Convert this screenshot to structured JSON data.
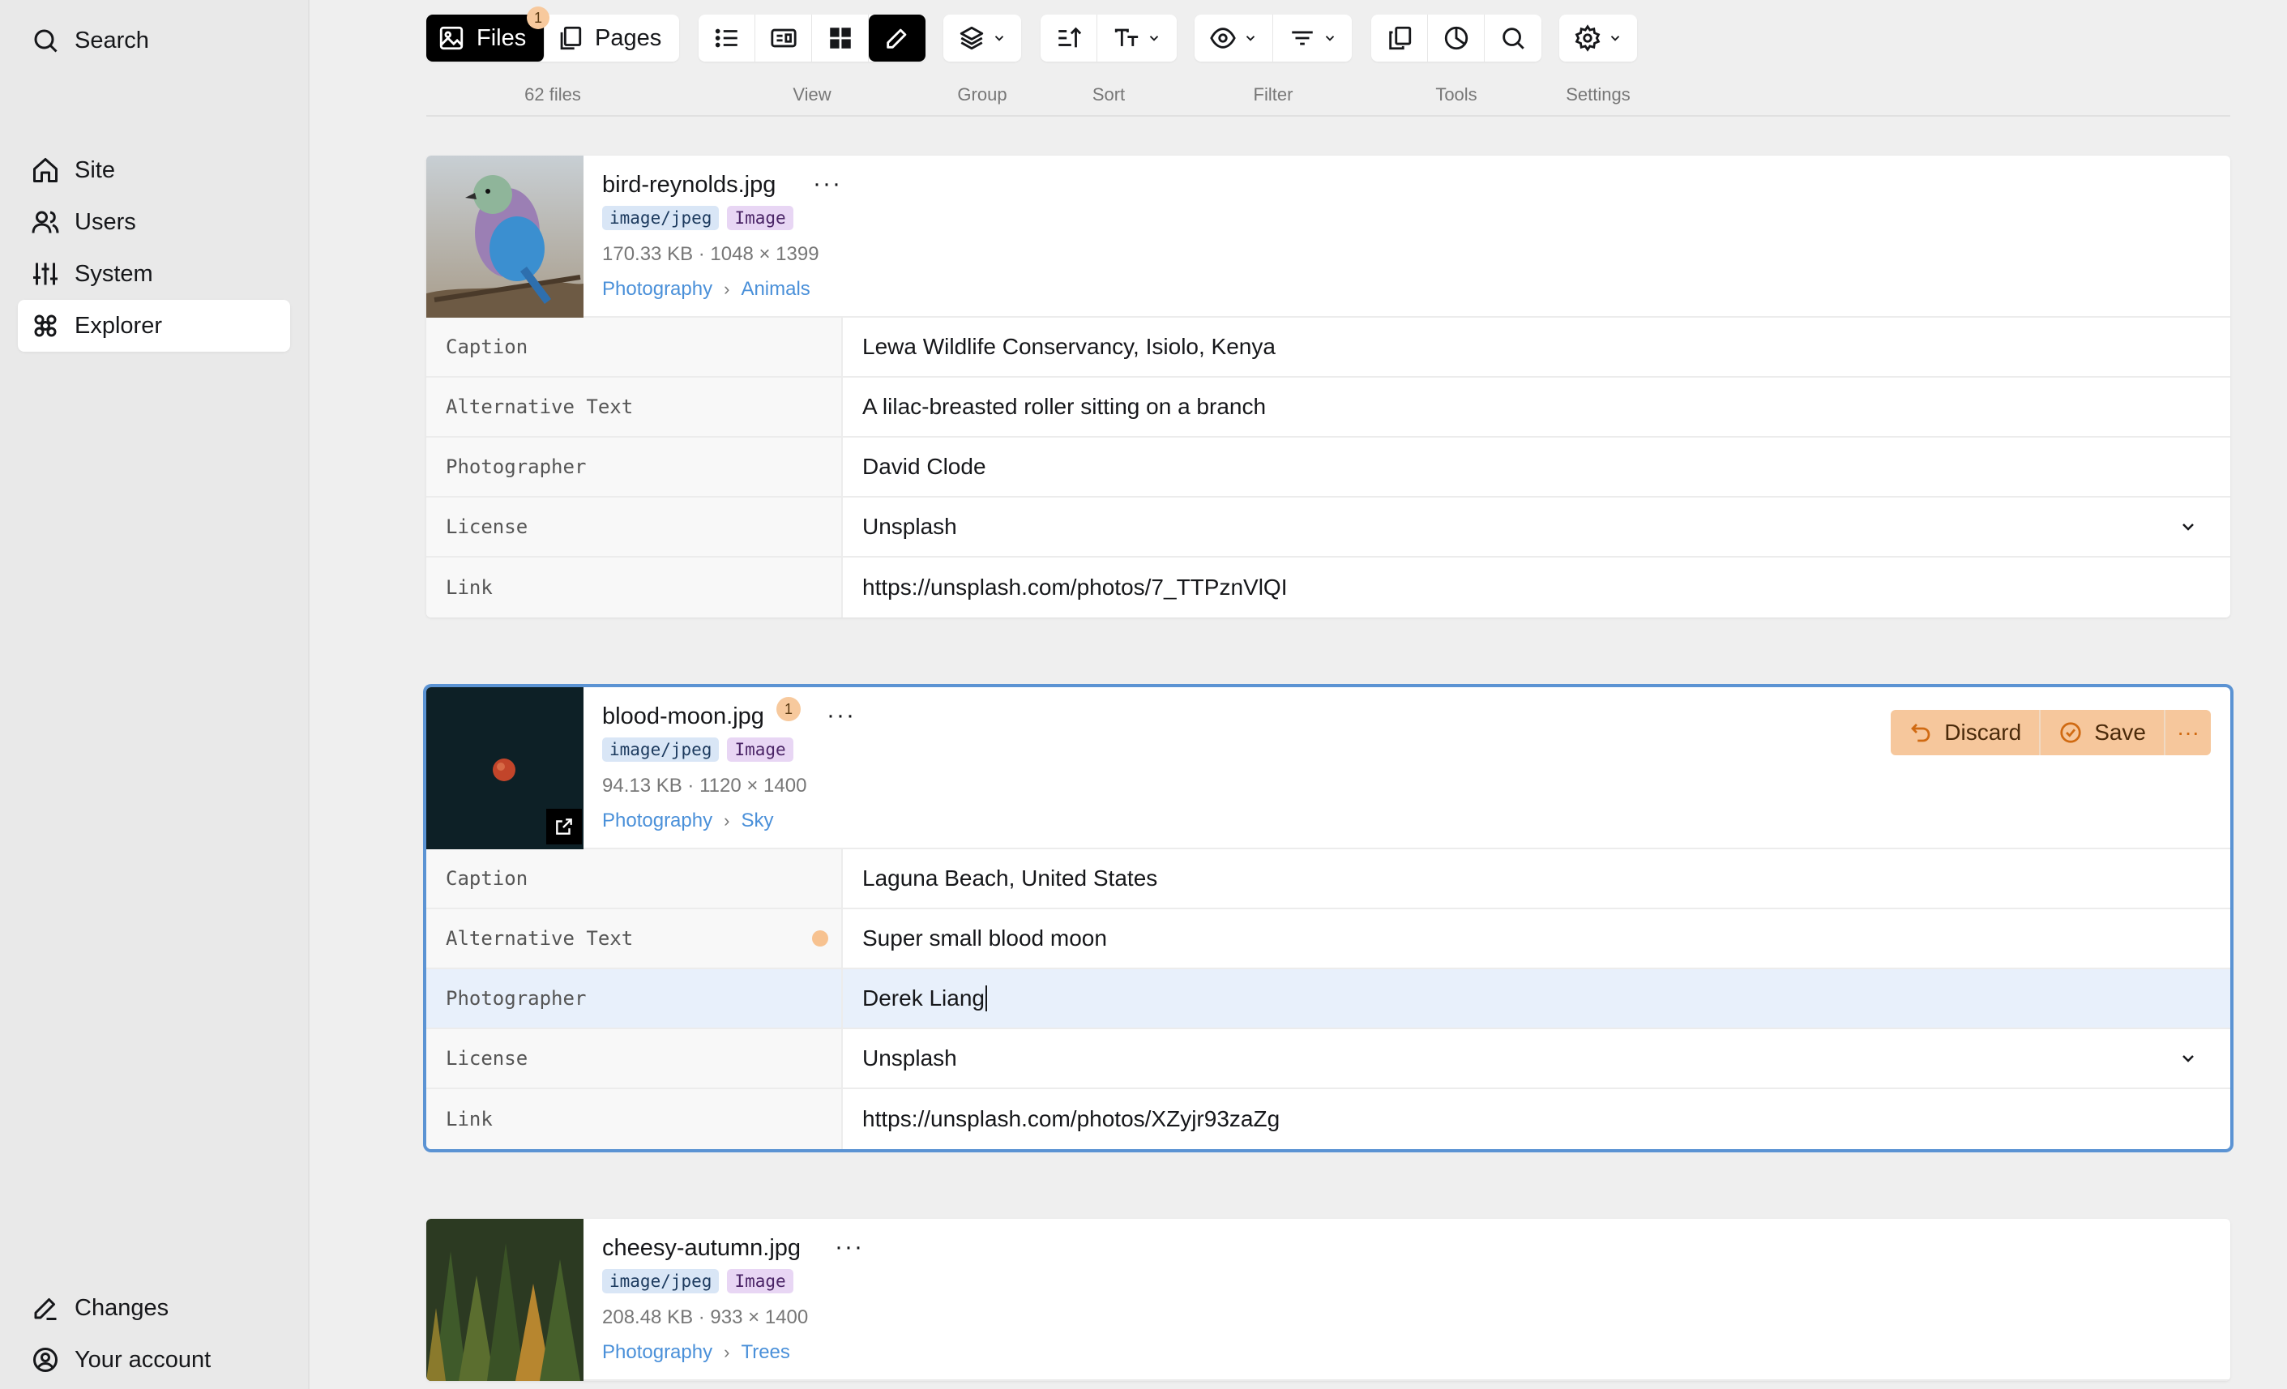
{
  "sidebar": {
    "search": "Search",
    "items": [
      {
        "label": "Site",
        "icon": "home-icon"
      },
      {
        "label": "Users",
        "icon": "users-icon"
      },
      {
        "label": "System",
        "icon": "sliders-icon"
      },
      {
        "label": "Explorer",
        "icon": "explorer-icon",
        "active": true
      }
    ],
    "bottom": [
      {
        "label": "Changes",
        "icon": "pencil-icon"
      },
      {
        "label": "Your account",
        "icon": "account-icon"
      }
    ]
  },
  "toolbar": {
    "files_label": "Files",
    "files_badge": "1",
    "pages_label": "Pages",
    "file_count": "62 files",
    "labels": {
      "view": "View",
      "group": "Group",
      "sort": "Sort",
      "filter": "Filter",
      "tools": "Tools",
      "settings": "Settings"
    }
  },
  "files": [
    {
      "name": "bird-reynolds.jpg",
      "mime": "image/jpeg",
      "kind": "Image",
      "meta": "170.33 KB · 1048 × 1399",
      "crumbs": [
        "Photography",
        "Animals"
      ],
      "fields": [
        {
          "key": "Caption",
          "value": "Lewa Wildlife Conservancy, Isiolo, Kenya"
        },
        {
          "key": "Alternative Text",
          "value": "A lilac-breasted roller sitting on a branch"
        },
        {
          "key": "Photographer",
          "value": "David Clode"
        },
        {
          "key": "License",
          "value": "Unsplash"
        },
        {
          "key": "Link",
          "value": "https://unsplash.com/photos/7_TTPznVlQI"
        }
      ]
    },
    {
      "name": "blood-moon.jpg",
      "badge": "1",
      "mime": "image/jpeg",
      "kind": "Image",
      "meta": "94.13 KB · 1120 × 1400",
      "crumbs": [
        "Photography",
        "Sky"
      ],
      "actions": {
        "discard": "Discard",
        "save": "Save"
      },
      "fields": [
        {
          "key": "Caption",
          "value": "Laguna Beach, United States"
        },
        {
          "key": "Alternative Text",
          "value": "Super small blood moon"
        },
        {
          "key": "Photographer",
          "value": "Derek Liang"
        },
        {
          "key": "License",
          "value": "Unsplash"
        },
        {
          "key": "Link",
          "value": "https://unsplash.com/photos/XZyjr93zaZg"
        }
      ]
    },
    {
      "name": "cheesy-autumn.jpg",
      "mime": "image/jpeg",
      "kind": "Image",
      "meta": "208.48 KB · 933 × 1400",
      "crumbs": [
        "Photography",
        "Trees"
      ]
    }
  ],
  "colors": {
    "accent": "#4a90d9",
    "selection": "#5b93d3",
    "changed": "#f6c79c"
  }
}
